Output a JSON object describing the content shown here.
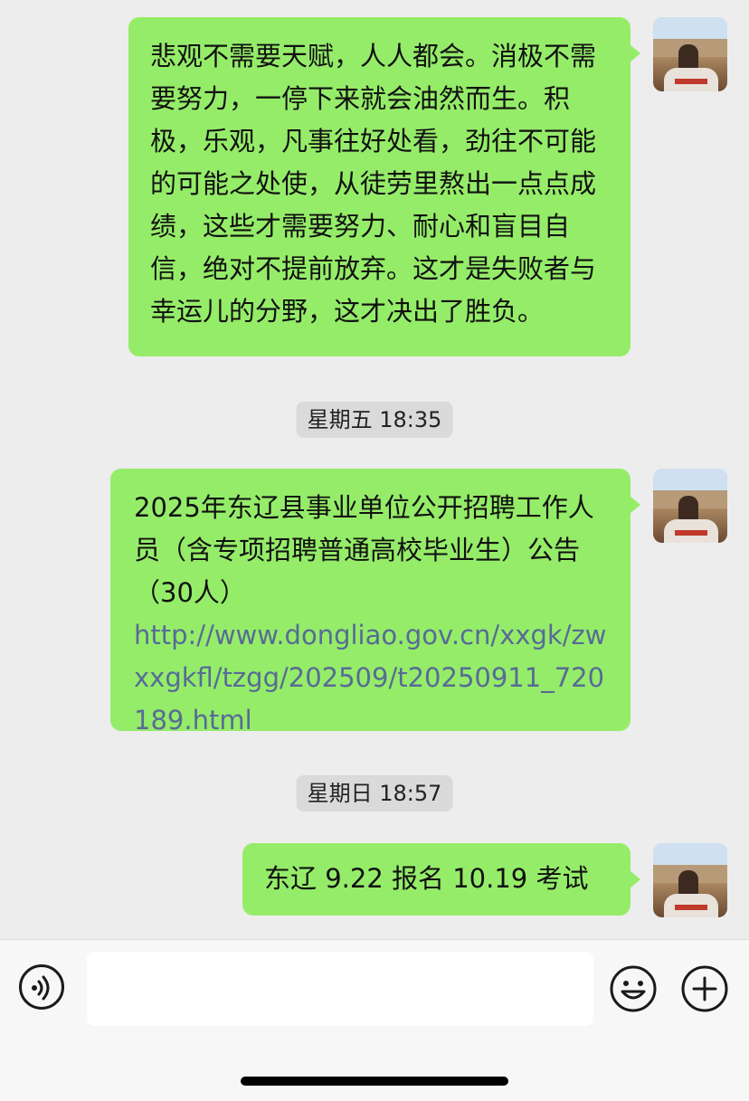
{
  "messages": [
    {
      "type": "text",
      "text": "悲观不需要天赋，人人都会。消极不需要努力，一停下来就会油然而生。积极，乐观，凡事往好处看，劲往不可能的可能之处使，从徒劳里熬出一点点成绩，这些才需要努力、耐心和盲目自信，绝对不提前放弃。这才是失败者与幸运儿的分野，这才决出了胜负。"
    },
    {
      "type": "timestamp",
      "text": "星期五 18:35"
    },
    {
      "type": "link",
      "title": "2025年东辽县事业单位公开招聘工作人员（含专项招聘普通高校毕业生）公告（30人）",
      "url": "http://www.dongliao.gov.cn/xxgk/zwxxgkfl/tzgg/202509/t20250911_720189.html"
    },
    {
      "type": "timestamp",
      "text": "星期日 18:57"
    },
    {
      "type": "text",
      "text": "东辽 9.22 报名 10.19 考试"
    }
  ],
  "input_bar": {
    "voice_icon": "voice-icon",
    "emoji_icon": "emoji-icon",
    "add_icon": "plus-icon",
    "input_value": ""
  },
  "colors": {
    "bubble": "#95ec69",
    "link": "#576b95",
    "background": "#ededed"
  }
}
